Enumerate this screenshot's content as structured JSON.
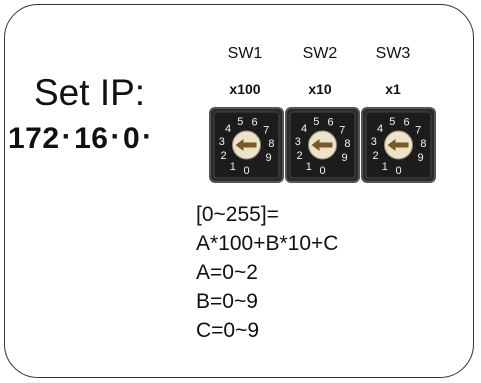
{
  "title": "Set IP:",
  "ip": {
    "octets": [
      "172",
      "16",
      "0"
    ],
    "separator": "·"
  },
  "switches": [
    {
      "name": "SW1",
      "multiplier": "x100"
    },
    {
      "name": "SW2",
      "multiplier": "x10"
    },
    {
      "name": "SW3",
      "multiplier": "x1"
    }
  ],
  "dial_digits": [
    "0",
    "1",
    "2",
    "3",
    "4",
    "5",
    "6",
    "7",
    "8",
    "9"
  ],
  "formula": {
    "line1": "[0~255]=",
    "line2": "A*100+B*10+C",
    "line3": "A=0~2",
    "line4": "B=0~9",
    "line5": "C=0~9"
  },
  "colors": {
    "dial_body": "#2b2b2b",
    "dial_border": "#555555",
    "knob": "#ece3c8",
    "arrow": "#7a5a28"
  }
}
